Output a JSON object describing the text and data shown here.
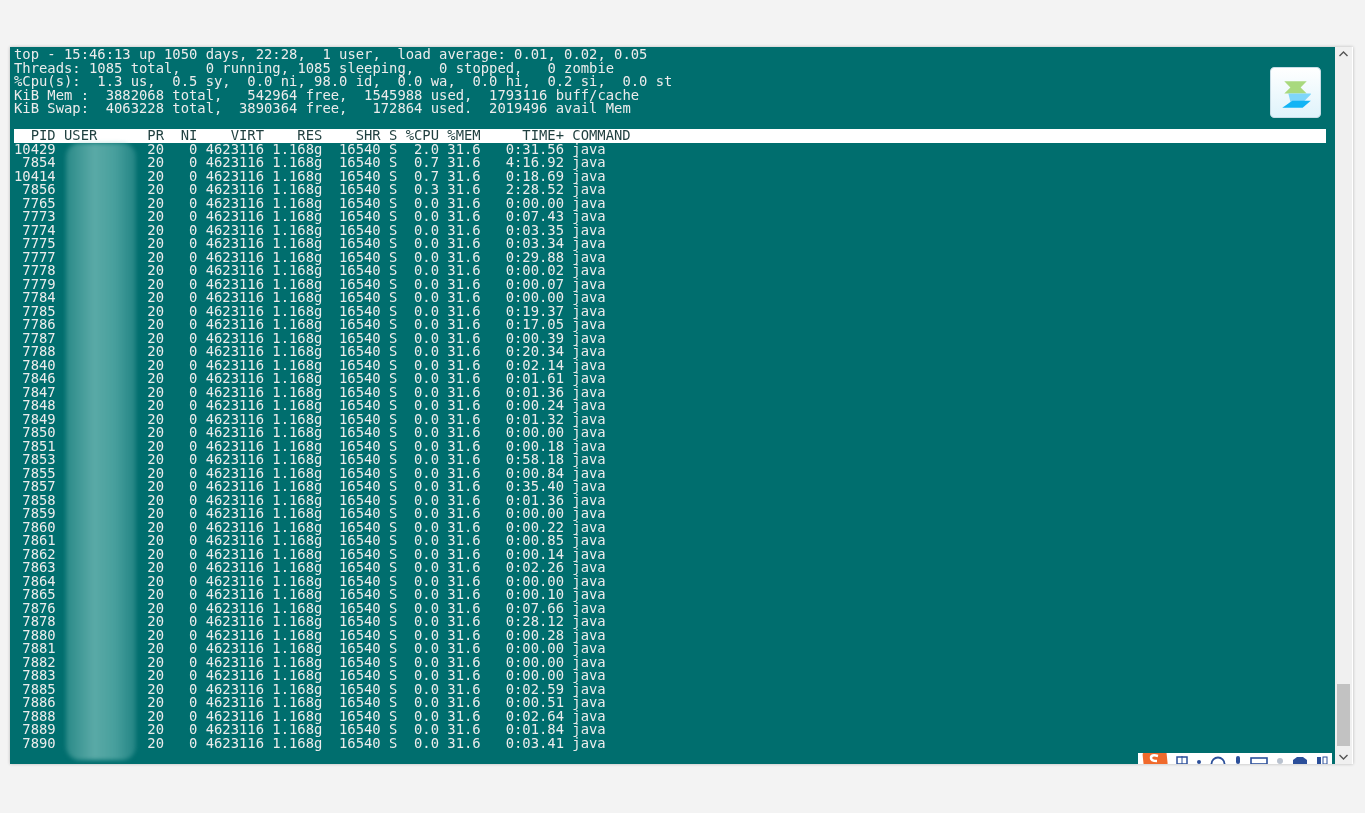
{
  "summary_lines": [
    "top - 15:46:13 up 1050 days, 22:28,  1 user,  load average: 0.01, 0.02, 0.05",
    "Threads: 1085 total,   0 running, 1085 sleeping,   0 stopped,   0 zombie",
    "%Cpu(s):  1.3 us,  0.5 sy,  0.0 ni, 98.0 id,  0.0 wa,  0.0 hi,  0.2 si,  0.0 st",
    "KiB Mem :  3882068 total,   542964 free,  1545988 used,  1793116 buff/cache",
    "KiB Swap:  4063228 total,  3890364 free,   172864 used.  2019496 avail Mem"
  ],
  "table": {
    "columns": [
      "PID",
      "USER",
      "PR",
      "NI",
      "VIRT",
      "RES",
      "SHR",
      "S",
      "%CPU",
      "%MEM",
      "TIME+",
      "COMMAND"
    ],
    "rows": [
      [
        "10429",
        "",
        "20",
        "0",
        "4623116",
        "1.168g",
        "16540",
        "S",
        "2.0",
        "31.6",
        "0:31.56",
        "java"
      ],
      [
        "7854",
        "",
        "20",
        "0",
        "4623116",
        "1.168g",
        "16540",
        "S",
        "0.7",
        "31.6",
        "4:16.92",
        "java"
      ],
      [
        "10414",
        "",
        "20",
        "0",
        "4623116",
        "1.168g",
        "16540",
        "S",
        "0.7",
        "31.6",
        "0:18.69",
        "java"
      ],
      [
        "7856",
        "",
        "20",
        "0",
        "4623116",
        "1.168g",
        "16540",
        "S",
        "0.3",
        "31.6",
        "2:28.52",
        "java"
      ],
      [
        "7765",
        "",
        "20",
        "0",
        "4623116",
        "1.168g",
        "16540",
        "S",
        "0.0",
        "31.6",
        "0:00.00",
        "java"
      ],
      [
        "7773",
        "",
        "20",
        "0",
        "4623116",
        "1.168g",
        "16540",
        "S",
        "0.0",
        "31.6",
        "0:07.43",
        "java"
      ],
      [
        "7774",
        "",
        "20",
        "0",
        "4623116",
        "1.168g",
        "16540",
        "S",
        "0.0",
        "31.6",
        "0:03.35",
        "java"
      ],
      [
        "7775",
        "",
        "20",
        "0",
        "4623116",
        "1.168g",
        "16540",
        "S",
        "0.0",
        "31.6",
        "0:03.34",
        "java"
      ],
      [
        "7777",
        "",
        "20",
        "0",
        "4623116",
        "1.168g",
        "16540",
        "S",
        "0.0",
        "31.6",
        "0:29.88",
        "java"
      ],
      [
        "7778",
        "",
        "20",
        "0",
        "4623116",
        "1.168g",
        "16540",
        "S",
        "0.0",
        "31.6",
        "0:00.02",
        "java"
      ],
      [
        "7779",
        "",
        "20",
        "0",
        "4623116",
        "1.168g",
        "16540",
        "S",
        "0.0",
        "31.6",
        "0:00.07",
        "java"
      ],
      [
        "7784",
        "",
        "20",
        "0",
        "4623116",
        "1.168g",
        "16540",
        "S",
        "0.0",
        "31.6",
        "0:00.00",
        "java"
      ],
      [
        "7785",
        "",
        "20",
        "0",
        "4623116",
        "1.168g",
        "16540",
        "S",
        "0.0",
        "31.6",
        "0:19.37",
        "java"
      ],
      [
        "7786",
        "",
        "20",
        "0",
        "4623116",
        "1.168g",
        "16540",
        "S",
        "0.0",
        "31.6",
        "0:17.05",
        "java"
      ],
      [
        "7787",
        "",
        "20",
        "0",
        "4623116",
        "1.168g",
        "16540",
        "S",
        "0.0",
        "31.6",
        "0:00.39",
        "java"
      ],
      [
        "7788",
        "",
        "20",
        "0",
        "4623116",
        "1.168g",
        "16540",
        "S",
        "0.0",
        "31.6",
        "0:20.34",
        "java"
      ],
      [
        "7840",
        "",
        "20",
        "0",
        "4623116",
        "1.168g",
        "16540",
        "S",
        "0.0",
        "31.6",
        "0:02.14",
        "java"
      ],
      [
        "7846",
        "",
        "20",
        "0",
        "4623116",
        "1.168g",
        "16540",
        "S",
        "0.0",
        "31.6",
        "0:01.61",
        "java"
      ],
      [
        "7847",
        "",
        "20",
        "0",
        "4623116",
        "1.168g",
        "16540",
        "S",
        "0.0",
        "31.6",
        "0:01.36",
        "java"
      ],
      [
        "7848",
        "",
        "20",
        "0",
        "4623116",
        "1.168g",
        "16540",
        "S",
        "0.0",
        "31.6",
        "0:00.24",
        "java"
      ],
      [
        "7849",
        "",
        "20",
        "0",
        "4623116",
        "1.168g",
        "16540",
        "S",
        "0.0",
        "31.6",
        "0:01.32",
        "java"
      ],
      [
        "7850",
        "",
        "20",
        "0",
        "4623116",
        "1.168g",
        "16540",
        "S",
        "0.0",
        "31.6",
        "0:00.00",
        "java"
      ],
      [
        "7851",
        "",
        "20",
        "0",
        "4623116",
        "1.168g",
        "16540",
        "S",
        "0.0",
        "31.6",
        "0:00.18",
        "java"
      ],
      [
        "7853",
        "",
        "20",
        "0",
        "4623116",
        "1.168g",
        "16540",
        "S",
        "0.0",
        "31.6",
        "0:58.18",
        "java"
      ],
      [
        "7855",
        "",
        "20",
        "0",
        "4623116",
        "1.168g",
        "16540",
        "S",
        "0.0",
        "31.6",
        "0:00.84",
        "java"
      ],
      [
        "7857",
        "",
        "20",
        "0",
        "4623116",
        "1.168g",
        "16540",
        "S",
        "0.0",
        "31.6",
        "0:35.40",
        "java"
      ],
      [
        "7858",
        "",
        "20",
        "0",
        "4623116",
        "1.168g",
        "16540",
        "S",
        "0.0",
        "31.6",
        "0:01.36",
        "java"
      ],
      [
        "7859",
        "",
        "20",
        "0",
        "4623116",
        "1.168g",
        "16540",
        "S",
        "0.0",
        "31.6",
        "0:00.00",
        "java"
      ],
      [
        "7860",
        "",
        "20",
        "0",
        "4623116",
        "1.168g",
        "16540",
        "S",
        "0.0",
        "31.6",
        "0:00.22",
        "java"
      ],
      [
        "7861",
        "",
        "20",
        "0",
        "4623116",
        "1.168g",
        "16540",
        "S",
        "0.0",
        "31.6",
        "0:00.85",
        "java"
      ],
      [
        "7862",
        "",
        "20",
        "0",
        "4623116",
        "1.168g",
        "16540",
        "S",
        "0.0",
        "31.6",
        "0:00.14",
        "java"
      ],
      [
        "7863",
        "",
        "20",
        "0",
        "4623116",
        "1.168g",
        "16540",
        "S",
        "0.0",
        "31.6",
        "0:02.26",
        "java"
      ],
      [
        "7864",
        "",
        "20",
        "0",
        "4623116",
        "1.168g",
        "16540",
        "S",
        "0.0",
        "31.6",
        "0:00.00",
        "java"
      ],
      [
        "7865",
        "",
        "20",
        "0",
        "4623116",
        "1.168g",
        "16540",
        "S",
        "0.0",
        "31.6",
        "0:00.10",
        "java"
      ],
      [
        "7876",
        "",
        "20",
        "0",
        "4623116",
        "1.168g",
        "16540",
        "S",
        "0.0",
        "31.6",
        "0:07.66",
        "java"
      ],
      [
        "7878",
        "",
        "20",
        "0",
        "4623116",
        "1.168g",
        "16540",
        "S",
        "0.0",
        "31.6",
        "0:28.12",
        "java"
      ],
      [
        "7880",
        "",
        "20",
        "0",
        "4623116",
        "1.168g",
        "16540",
        "S",
        "0.0",
        "31.6",
        "0:00.28",
        "java"
      ],
      [
        "7881",
        "",
        "20",
        "0",
        "4623116",
        "1.168g",
        "16540",
        "S",
        "0.0",
        "31.6",
        "0:00.00",
        "java"
      ],
      [
        "7882",
        "",
        "20",
        "0",
        "4623116",
        "1.168g",
        "16540",
        "S",
        "0.0",
        "31.6",
        "0:00.00",
        "java"
      ],
      [
        "7883",
        "",
        "20",
        "0",
        "4623116",
        "1.168g",
        "16540",
        "S",
        "0.0",
        "31.6",
        "0:00.00",
        "java"
      ],
      [
        "7885",
        "",
        "20",
        "0",
        "4623116",
        "1.168g",
        "16540",
        "S",
        "0.0",
        "31.6",
        "0:02.59",
        "java"
      ],
      [
        "7886",
        "",
        "20",
        "0",
        "4623116",
        "1.168g",
        "16540",
        "S",
        "0.0",
        "31.6",
        "0:00.51",
        "java"
      ],
      [
        "7888",
        "",
        "20",
        "0",
        "4623116",
        "1.168g",
        "16540",
        "S",
        "0.0",
        "31.6",
        "0:02.64",
        "java"
      ],
      [
        "7889",
        "",
        "20",
        "0",
        "4623116",
        "1.168g",
        "16540",
        "S",
        "0.0",
        "31.6",
        "0:01.84",
        "java"
      ],
      [
        "7890",
        "",
        "20",
        "0",
        "4623116",
        "1.168g",
        "16540",
        "S",
        "0.0",
        "31.6",
        "0:03.41",
        "java"
      ]
    ]
  }
}
